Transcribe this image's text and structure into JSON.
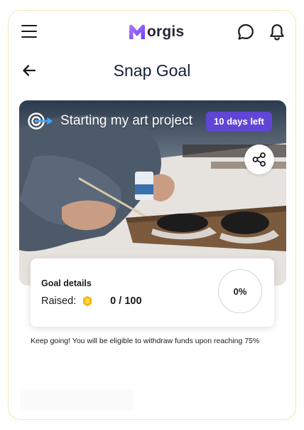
{
  "header": {
    "logo_text": "orgis",
    "logo_color": "#8a5cf6",
    "menu_icon": "hamburger-icon",
    "chat_icon": "chat-bubble-icon",
    "notification_icon": "bell-icon"
  },
  "title_bar": {
    "back_icon": "arrow-left-icon",
    "title": "Snap Goal"
  },
  "goal": {
    "name": "Starting my art project",
    "badge": "10 days left",
    "badge_color": "#6046d6",
    "share_icon": "share-icon",
    "goal_icon": "target-arrow-icon"
  },
  "details": {
    "label": "Goal details",
    "raised_label": "Raised:",
    "coin_icon": "coin-icon",
    "coin_color": "#f4b400",
    "raised_value": "0 / 100",
    "progress_percent": "0%",
    "progress_fraction": 0
  },
  "note": "Keep going! You will be eligible to withdraw funds upon reaching 75%"
}
